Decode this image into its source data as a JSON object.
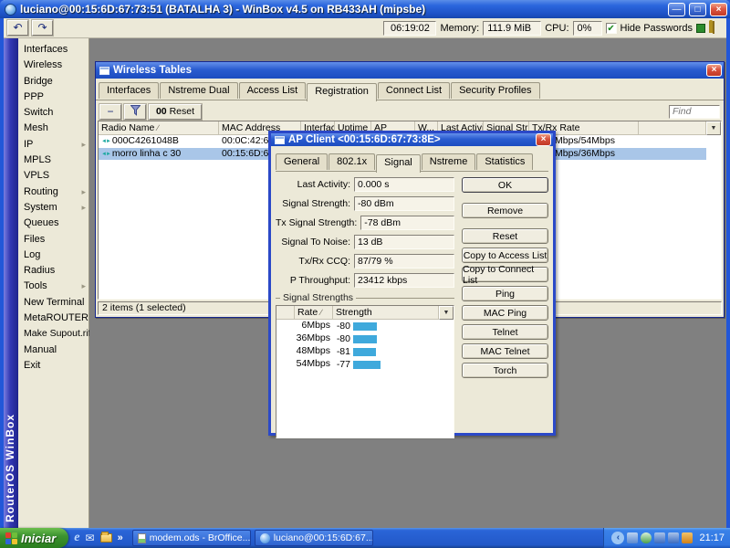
{
  "icons": {
    "close": "×",
    "minimize": "—",
    "maximize": "□",
    "undo": "↶",
    "redo": "↷",
    "dropdown": "▼",
    "submenu": "▸",
    "checkmark": "✔",
    "sort": "∕",
    "row_link": "◄►",
    "quick_launch_more": "»",
    "tray_collapse": "‹",
    "minus": "−",
    "ie": "e",
    "mail": "✉"
  },
  "titlebar": {
    "title": "luciano@00:15:6D:67:73:51 (BATALHA 3) - WinBox v4.5 on RB433AH (mipsbe)"
  },
  "topbar": {
    "time": "06:19:02",
    "memory_label": "Memory:",
    "memory_value": "111.9 MiB",
    "cpu_label": "CPU:",
    "cpu_value": "0%",
    "hide_passwords": "Hide Passwords"
  },
  "sidebar": {
    "brand": "RouterOS WinBox",
    "items": [
      {
        "label": "Interfaces"
      },
      {
        "label": "Wireless"
      },
      {
        "label": "Bridge"
      },
      {
        "label": "PPP"
      },
      {
        "label": "Switch"
      },
      {
        "label": "Mesh"
      },
      {
        "label": "IP",
        "submenu": true
      },
      {
        "label": "MPLS"
      },
      {
        "label": "VPLS"
      },
      {
        "label": "Routing",
        "submenu": true
      },
      {
        "label": "System",
        "submenu": true
      },
      {
        "label": "Queues"
      },
      {
        "label": "Files"
      },
      {
        "label": "Log"
      },
      {
        "label": "Radius"
      },
      {
        "label": "Tools",
        "submenu": true
      },
      {
        "label": "New Terminal"
      },
      {
        "label": "MetaROUTER"
      },
      {
        "label": "Make Supout.rif"
      },
      {
        "label": "Manual"
      },
      {
        "label": "Exit"
      }
    ]
  },
  "wireless_window": {
    "title": "Wireless Tables",
    "tabs": [
      {
        "label": "Interfaces"
      },
      {
        "label": "Nstreme Dual"
      },
      {
        "label": "Access List"
      },
      {
        "label": "Registration"
      },
      {
        "label": "Connect List"
      },
      {
        "label": "Security Profiles"
      }
    ],
    "active_tab": "Registration",
    "toolbar": {
      "reset_prefix": "00",
      "reset_label": "Reset",
      "find_placeholder": "Find"
    },
    "table": {
      "headers": [
        "Radio Name",
        "MAC Address",
        "Interface",
        "Uptime",
        "AP",
        "W...",
        "Last Activit...",
        "Signal Strengt...",
        "Tx/Rx Rate"
      ],
      "rows": [
        {
          "radio_name": "000C4261048B",
          "mac_address": "00:0C:42:61:0",
          "tx_rx_rate": "Mbps/54Mbps"
        },
        {
          "radio_name": "morro linha c 30",
          "mac_address": "00:15:6D:67:7",
          "tx_rx_rate": "Mbps/36Mbps"
        }
      ]
    },
    "status": "2 items (1 selected)"
  },
  "dialog": {
    "title": "AP Client <00:15:6D:67:73:8E>",
    "tabs": [
      {
        "label": "General"
      },
      {
        "label": "802.1x"
      },
      {
        "label": "Signal"
      },
      {
        "label": "Nstreme"
      },
      {
        "label": "Statistics"
      }
    ],
    "active_tab": "Signal",
    "fields": [
      {
        "label": "Last Activity:",
        "value": "0.000 s"
      },
      {
        "label": "Signal Strength:",
        "value": "-80 dBm"
      },
      {
        "label": "Tx Signal Strength:",
        "value": "-78 dBm"
      },
      {
        "label": "Signal To Noise:",
        "value": "13 dB"
      },
      {
        "label": "Tx/Rx CCQ:",
        "value": "87/79 %"
      },
      {
        "label": "P Throughput:",
        "value": "23412 kbps"
      }
    ],
    "signal_strengths": {
      "group_label": "Signal Strengths",
      "columns": [
        "Rate",
        "Strength"
      ],
      "rows": [
        {
          "rate": "6Mbps",
          "strength": "-80"
        },
        {
          "rate": "36Mbps",
          "strength": "-80"
        },
        {
          "rate": "48Mbps",
          "strength": "-81"
        },
        {
          "rate": "54Mbps",
          "strength": "-77"
        }
      ]
    },
    "buttons": [
      {
        "label": "OK"
      },
      {
        "label": "Remove"
      },
      {
        "label": "Reset"
      },
      {
        "label": "Copy to Access List"
      },
      {
        "label": "Copy to Connect List"
      },
      {
        "label": "Ping"
      },
      {
        "label": "MAC Ping"
      },
      {
        "label": "Telnet"
      },
      {
        "label": "MAC Telnet"
      },
      {
        "label": "Torch"
      }
    ]
  },
  "taskbar": {
    "start_label": "Iniciar",
    "tasks": [
      {
        "label": "modem.ods - BrOffice..."
      },
      {
        "label": "luciano@00:15:6D:67..."
      }
    ],
    "clock": "21:17"
  },
  "colors": {
    "titlebar_blue": "#1e55c8",
    "selection": "#a9c6e8",
    "signal_bar": "#3fa9dc",
    "desktop": "#808080"
  }
}
